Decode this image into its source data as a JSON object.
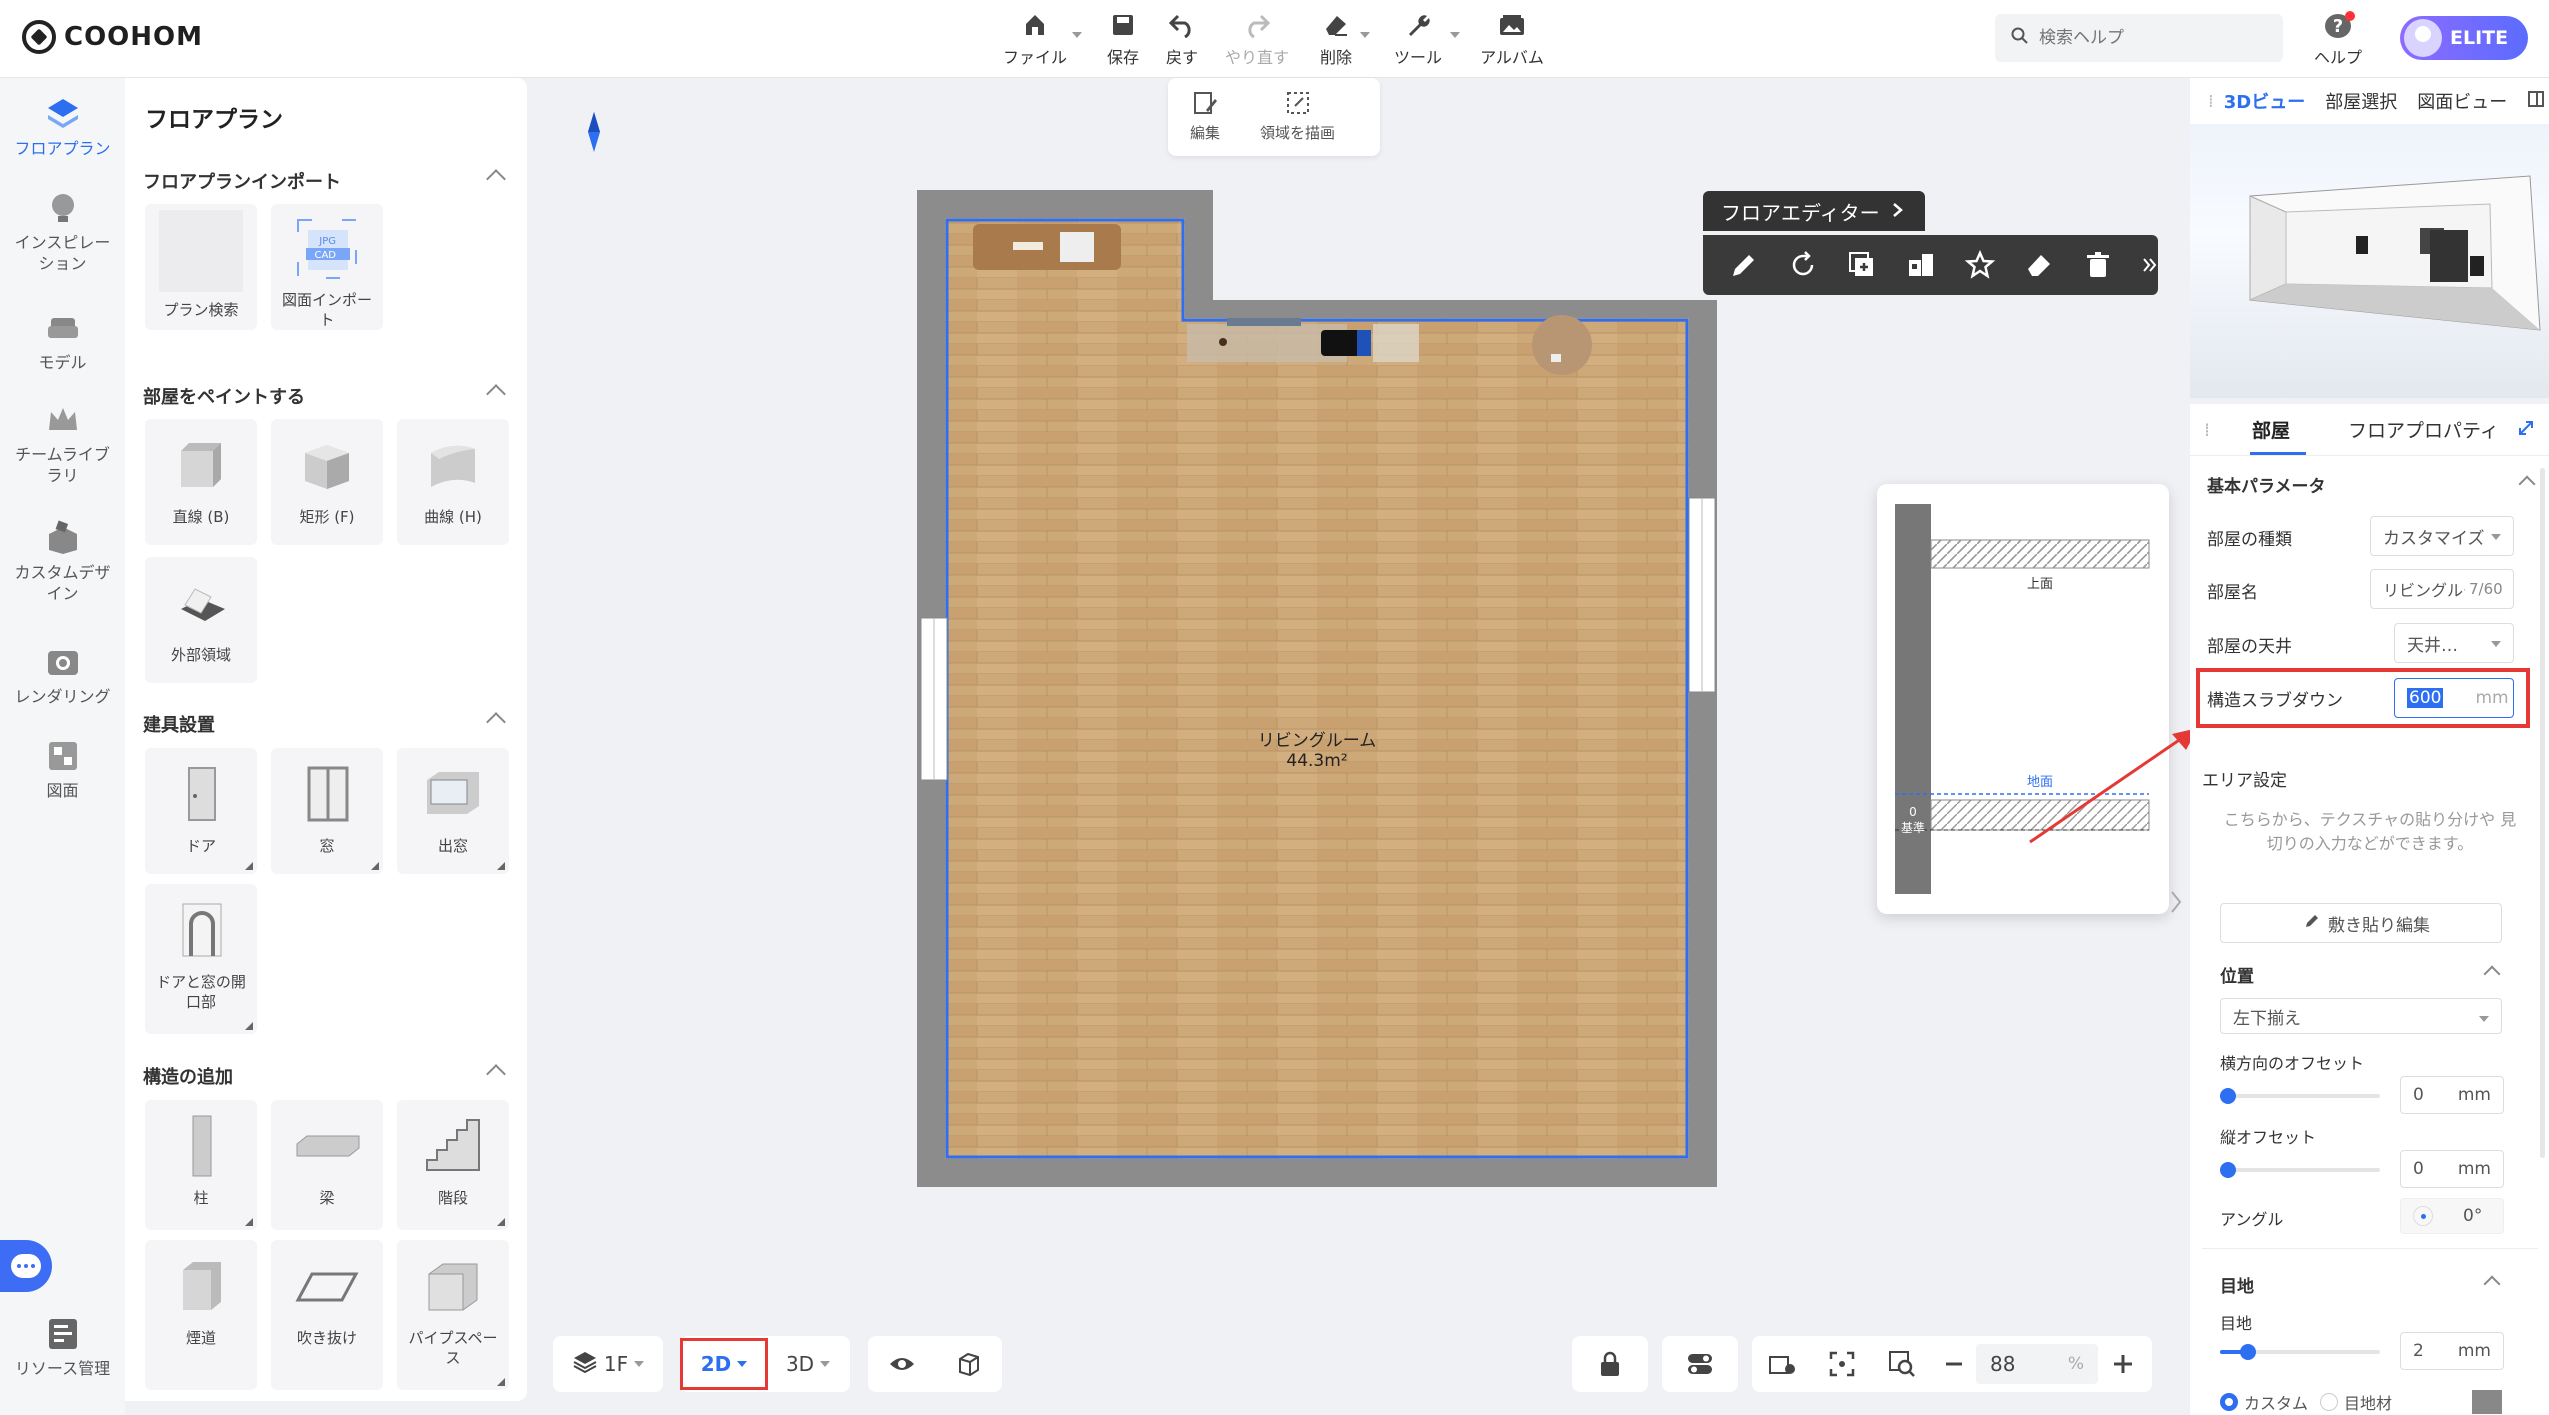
{
  "app": {
    "logo": "COOHOM"
  },
  "toolbar": {
    "file": "ファイル",
    "save": "保存",
    "undo": "戻す",
    "redo": "やり直す",
    "delete": "削除",
    "tools": "ツール",
    "album": "アルバム"
  },
  "search": {
    "placeholder": "検索ヘルプ"
  },
  "help": {
    "label": "ヘルプ"
  },
  "account": {
    "badge": "ELITE"
  },
  "leftnav": [
    {
      "label": "フロアプラン"
    },
    {
      "label": "インスピレーション"
    },
    {
      "label": "モデル"
    },
    {
      "label": "チームライブラリ"
    },
    {
      "label": "カスタムデザイン"
    },
    {
      "label": "レンダリング"
    },
    {
      "label": "図面"
    },
    {
      "label": "リソース管理"
    }
  ],
  "panel": {
    "title": "フロアプラン",
    "sections": [
      {
        "title": "フロアプランインポート",
        "items": [
          "プラン検索",
          "図面インポート"
        ]
      },
      {
        "title": "部屋をペイントする",
        "items": [
          "直線 (B)",
          "矩形 (F)",
          "曲線 (H)",
          "外部領域"
        ]
      },
      {
        "title": "建具設置",
        "items": [
          "ドア",
          "窓",
          "出窓",
          "ドアと窓の開口部"
        ]
      },
      {
        "title": "構造の追加",
        "items": [
          "柱",
          "梁",
          "階段",
          "煙道",
          "吹き抜け",
          "パイプスペース"
        ]
      }
    ],
    "import_badges": {
      "jpg": "JPG",
      "cad": "CAD"
    }
  },
  "canvas_toolbar": {
    "edit": "編集",
    "draw_area": "領域を描画"
  },
  "room": {
    "name": "リビングルーム",
    "area": "44.3m²"
  },
  "floor_editor": {
    "label": "フロアエディター"
  },
  "popup": {
    "top_label": "上面",
    "ground_label": "地面",
    "zero": "0",
    "base": "基準"
  },
  "bottom": {
    "floor": "1F",
    "mode2d": "2D",
    "mode3d": "3D",
    "zoom": "88",
    "zoom_unit": "%"
  },
  "right": {
    "view_tabs": [
      "3Dビュー",
      "部屋選択",
      "図面ビュー"
    ],
    "prop_tabs": [
      "部屋",
      "フロアプロパティ"
    ],
    "basic_params": "基本パラメータ",
    "room_type_label": "部屋の種類",
    "room_type_value": "カスタマイズ",
    "room_name_label": "部屋名",
    "room_name_value": "リビングルー⁠ム",
    "room_name_count": "7/60",
    "ceiling_label": "部屋の天井",
    "ceiling_value": "天井…",
    "slab_label": "構造スラブダウン",
    "slab_value": "600",
    "slab_unit": "mm",
    "area_settings": "エリア設定",
    "area_desc": "こちらから、テクスチャの貼り分けや 見切りの入力などができます。",
    "paving_btn": "敷き貼り編集",
    "position": "位置",
    "align_value": "左下揃え",
    "h_offset_label": "横方向のオフセット",
    "h_offset_value": "0",
    "h_offset_unit": "mm",
    "v_offset_label": "縦オフセット",
    "v_offset_value": "0",
    "v_offset_unit": "mm",
    "angle_label": "アングル",
    "angle_value": "0°",
    "joint_section": "目地",
    "joint_label": "目地",
    "joint_value": "2",
    "joint_unit": "mm",
    "radio_custom": "カスタム",
    "radio_material": "目地材"
  },
  "colors": {
    "accent": "#2d6ff0",
    "highlight": "#e53935",
    "wall": "#8c8c8c",
    "floor": "#c9a779"
  }
}
